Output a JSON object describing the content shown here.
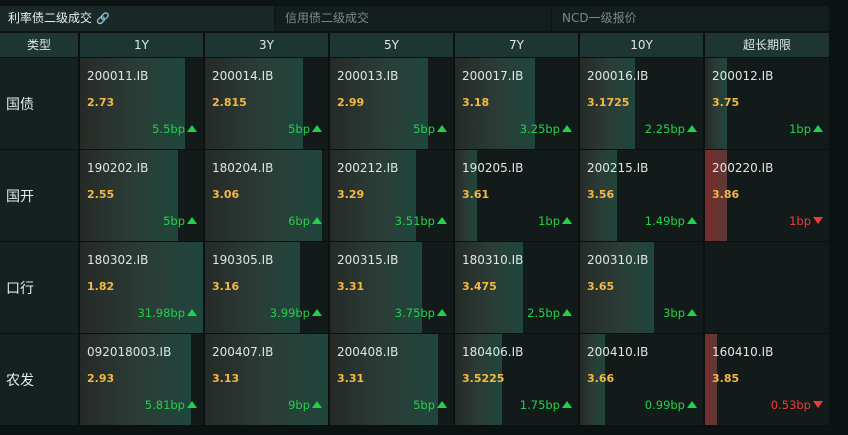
{
  "tabs": [
    {
      "label": "利率债二级成交",
      "active": true
    },
    {
      "label": "信用债二级成交",
      "active": false
    },
    {
      "label": "NCD一级报价",
      "active": false
    }
  ],
  "headers": [
    "类型",
    "1Y",
    "3Y",
    "5Y",
    "7Y",
    "10Y",
    "超长期限"
  ],
  "rows": [
    {
      "label": "国债",
      "cells": [
        {
          "code": "200011.IB",
          "yield": "2.73",
          "change": "5.5bp",
          "dir": "up",
          "fill": 0.85
        },
        {
          "code": "200014.IB",
          "yield": "2.815",
          "change": "5bp",
          "dir": "up",
          "fill": 0.8
        },
        {
          "code": "200013.IB",
          "yield": "2.99",
          "change": "5bp",
          "dir": "up",
          "fill": 0.8
        },
        {
          "code": "200017.IB",
          "yield": "3.18",
          "change": "3.25bp",
          "dir": "up",
          "fill": 0.65
        },
        {
          "code": "200016.IB",
          "yield": "3.1725",
          "change": "2.25bp",
          "dir": "up",
          "fill": 0.45
        },
        {
          "code": "200012.IB",
          "yield": "3.75",
          "change": "1bp",
          "dir": "up",
          "fill": 0.18
        }
      ]
    },
    {
      "label": "国开",
      "cells": [
        {
          "code": "190202.IB",
          "yield": "2.55",
          "change": "5bp",
          "dir": "up",
          "fill": 0.8
        },
        {
          "code": "180204.IB",
          "yield": "3.06",
          "change": "6bp",
          "dir": "up",
          "fill": 0.95
        },
        {
          "code": "200212.IB",
          "yield": "3.29",
          "change": "3.51bp",
          "dir": "up",
          "fill": 0.7
        },
        {
          "code": "190205.IB",
          "yield": "3.61",
          "change": "1bp",
          "dir": "up",
          "fill": 0.18
        },
        {
          "code": "200215.IB",
          "yield": "3.56",
          "change": "1.49bp",
          "dir": "up",
          "fill": 0.3
        },
        {
          "code": "200220.IB",
          "yield": "3.86",
          "change": "1bp",
          "dir": "down",
          "fill": 0.18
        }
      ]
    },
    {
      "label": "口行",
      "cells": [
        {
          "code": "180302.IB",
          "yield": "1.82",
          "change": "31.98bp",
          "dir": "up",
          "fill": 1.0
        },
        {
          "code": "190305.IB",
          "yield": "3.16",
          "change": "3.99bp",
          "dir": "up",
          "fill": 0.77
        },
        {
          "code": "200315.IB",
          "yield": "3.31",
          "change": "3.75bp",
          "dir": "up",
          "fill": 0.75
        },
        {
          "code": "180310.IB",
          "yield": "3.475",
          "change": "2.5bp",
          "dir": "up",
          "fill": 0.55
        },
        {
          "code": "200310.IB",
          "yield": "3.65",
          "change": "3bp",
          "dir": "up",
          "fill": 0.6
        },
        {
          "code": "",
          "yield": "",
          "change": "",
          "dir": "",
          "fill": 0
        }
      ]
    },
    {
      "label": "农发",
      "cells": [
        {
          "code": "092018003.IB",
          "yield": "2.93",
          "change": "5.81bp",
          "dir": "up",
          "fill": 0.9
        },
        {
          "code": "200407.IB",
          "yield": "3.13",
          "change": "9bp",
          "dir": "up",
          "fill": 1.0
        },
        {
          "code": "200408.IB",
          "yield": "3.31",
          "change": "5bp",
          "dir": "up",
          "fill": 0.88
        },
        {
          "code": "180406.IB",
          "yield": "3.5225",
          "change": "1.75bp",
          "dir": "up",
          "fill": 0.38
        },
        {
          "code": "200410.IB",
          "yield": "3.66",
          "change": "0.99bp",
          "dir": "up",
          "fill": 0.2
        },
        {
          "code": "160410.IB",
          "yield": "3.85",
          "change": "0.53bp",
          "dir": "down",
          "fill": 0.1
        }
      ]
    }
  ],
  "colors": {
    "up": "#22d14a",
    "down": "#f03a3a",
    "yield": "#f5b942",
    "header_bg": "#1e3632"
  }
}
